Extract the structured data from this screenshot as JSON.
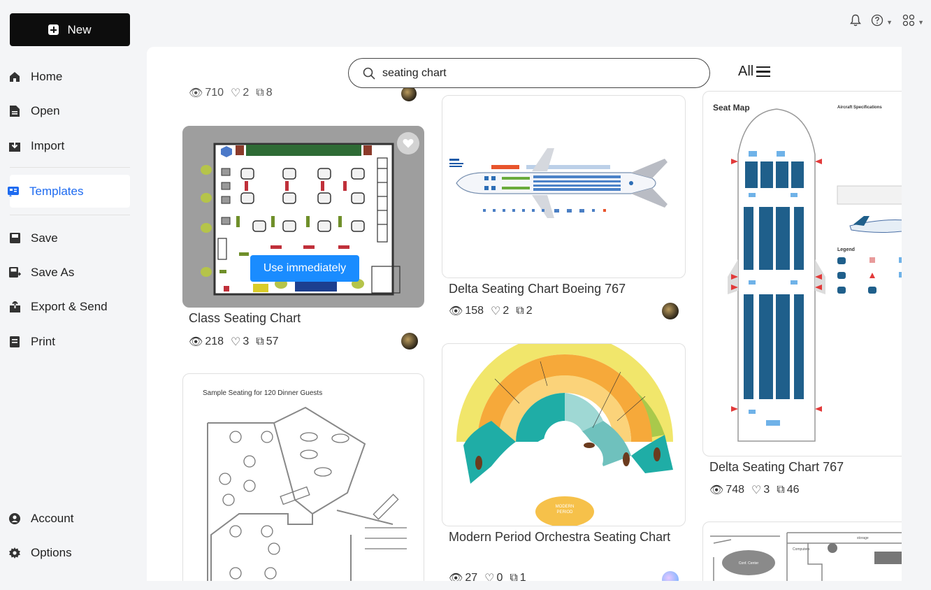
{
  "sidebar": {
    "new_label": "New",
    "items": [
      {
        "label": "Home",
        "icon": "home-icon"
      },
      {
        "label": "Open",
        "icon": "open-icon"
      },
      {
        "label": "Import",
        "icon": "import-icon"
      },
      {
        "label": "Templates",
        "icon": "templates-icon",
        "active": true
      },
      {
        "label": "Save",
        "icon": "save-icon"
      },
      {
        "label": "Save As",
        "icon": "save-as-icon"
      },
      {
        "label": "Export & Send",
        "icon": "export-icon"
      },
      {
        "label": "Print",
        "icon": "print-icon"
      },
      {
        "label": "Account",
        "icon": "account-icon"
      },
      {
        "label": "Options",
        "icon": "options-icon"
      }
    ]
  },
  "search": {
    "value": "seating chart",
    "placeholder": "Search templates"
  },
  "filter": {
    "label": "All"
  },
  "accent_color": "#1e6bf0",
  "cards": {
    "partial_top": {
      "views": "710",
      "likes": "2",
      "copies": "8"
    },
    "class": {
      "title": "Class Seating Chart",
      "views": "218",
      "likes": "3",
      "copies": "57",
      "use_label": "Use immediately"
    },
    "dinner": {
      "heading": "Sample Seating for 120 Dinner Guests"
    },
    "boeing": {
      "title": "Delta Seating Chart Boeing 767",
      "views": "158",
      "likes": "2",
      "copies": "2"
    },
    "orchestra": {
      "title": "Modern Period Orchestra Seating Chart",
      "views": "27",
      "likes": "0",
      "copies": "1",
      "badge": "MODERN PERIOD"
    },
    "delta767": {
      "title": "Delta Seating Chart 767",
      "views": "748",
      "likes": "3",
      "copies": "46",
      "heading": "Seat Map",
      "subheading": "Aircraft Specifications",
      "legend": "Legend"
    },
    "office": {
      "label1": "Conf. Center",
      "label2": "Computers",
      "label3": "storage"
    }
  }
}
